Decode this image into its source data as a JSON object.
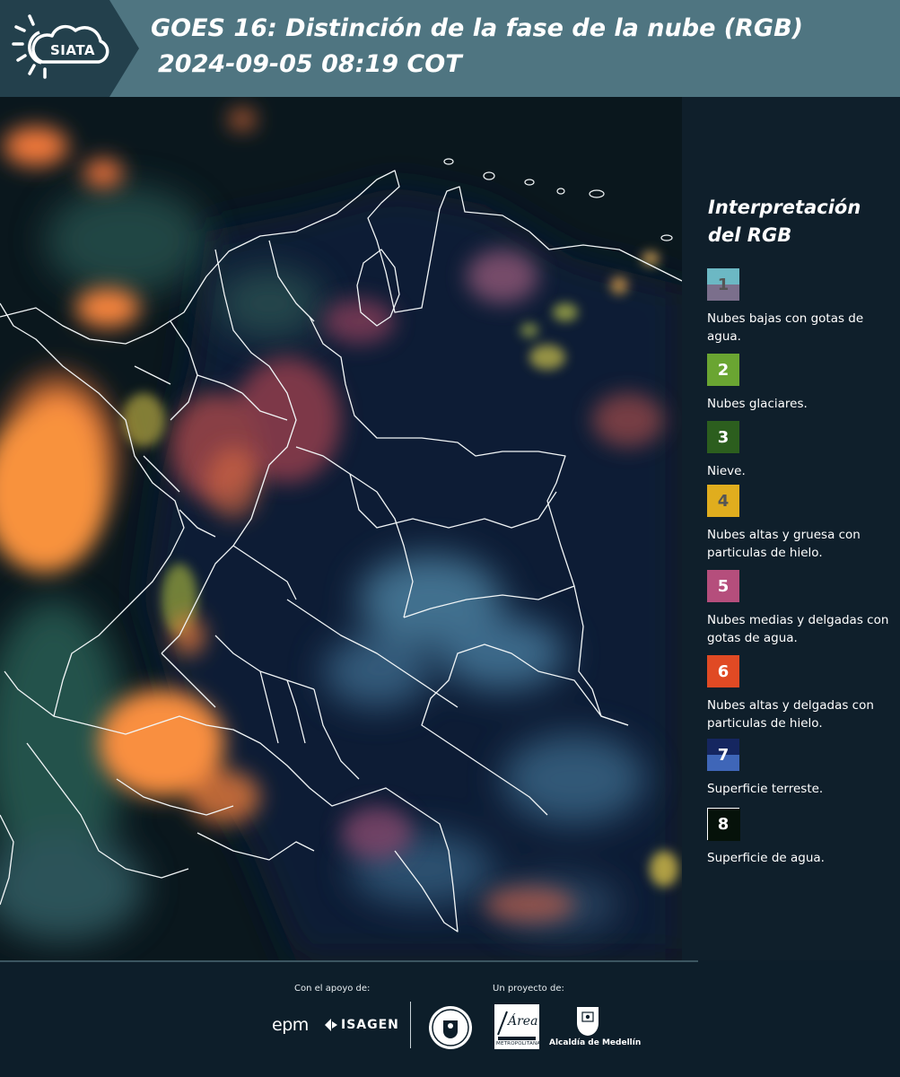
{
  "header": {
    "logo_text": "SIATA",
    "title": "GOES 16: Distinción de la fase de la nube (RGB)",
    "subtitle": "2024-09-05 08:19 COT",
    "background": "#4f7581"
  },
  "legend": {
    "title": "Interpretación del RGB",
    "items": [
      {
        "number": "1",
        "label": "Nubes bajas con gotas de agua.",
        "color_top": "#6cb8c4",
        "color_bottom": "#7b6f8c",
        "text_color": "#555555"
      },
      {
        "number": "2",
        "label": "Nubes glaciares.",
        "color_top": "#6aa532",
        "color_bottom": "#6aa532",
        "text_color": "#ffffff"
      },
      {
        "number": "3",
        "label": "Nieve.",
        "color_top": "#2c5e1e",
        "color_bottom": "#2c5e1e",
        "text_color": "#ffffff"
      },
      {
        "number": "4",
        "label": "Nubes altas y gruesa con particulas de hielo.",
        "color_top": "#e0ad1e",
        "color_bottom": "#e0ad1e",
        "text_color": "#555555"
      },
      {
        "number": "5",
        "label": "Nubes medias y delgadas con gotas de agua.",
        "color_top": "#b54e7c",
        "color_bottom": "#b54e7c",
        "text_color": "#ffffff"
      },
      {
        "number": "6",
        "label": "Nubes altas y delgadas con particulas de hielo.",
        "color_top": "#e04a24",
        "color_bottom": "#e04a24",
        "text_color": "#ffffff"
      },
      {
        "number": "7",
        "label": "Superficie terreste.",
        "color_top": "#152660",
        "color_bottom": "#3f66b8",
        "text_color": "#ffffff"
      },
      {
        "number": "8",
        "label": "Superficie de agua.",
        "color_top": "#06120a",
        "color_bottom": "#06120a",
        "text_color": "#ffffff"
      }
    ]
  },
  "footer": {
    "support_label": "Con el apoyo de:",
    "project_label": "Un proyecto de:",
    "sponsors": [
      "epm",
      "ISAGEN"
    ],
    "partners": [
      "Área Metropolitana Valle de Aburrá",
      "Alcaldía de Medellín"
    ],
    "alcaldia_text": "Alcaldía de Medellín",
    "area_text": "Área",
    "area_sub": "METROPOLITANA"
  },
  "icons": {
    "logo": "sun-cloud-icon",
    "seal": "university-seal-icon",
    "area": "area-metropolitana-logo",
    "alcaldia": "medellin-coat-of-arms-icon"
  }
}
